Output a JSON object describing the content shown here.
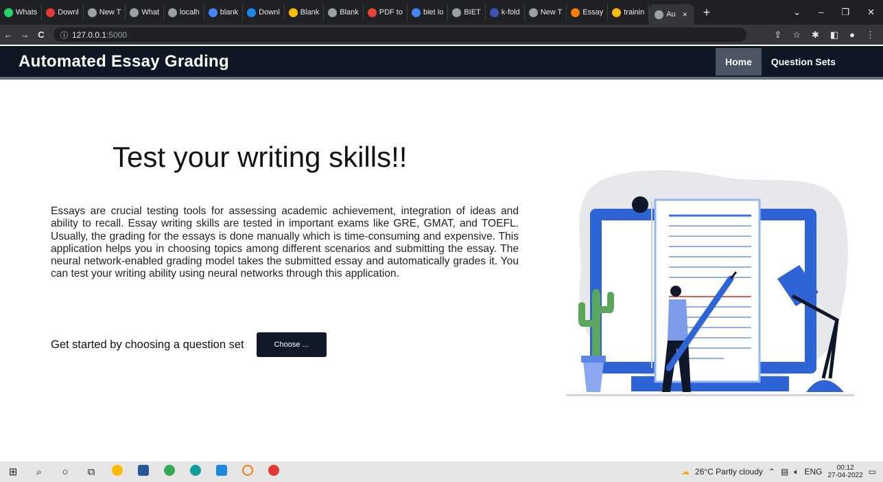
{
  "browser": {
    "tabs": [
      {
        "label": "Whats",
        "color": "#25d366"
      },
      {
        "label": "Downl",
        "color": "#e53935"
      },
      {
        "label": "New T",
        "color": "#9aa0a6"
      },
      {
        "label": "What",
        "color": "#9aa0a6"
      },
      {
        "label": "localh",
        "color": "#9aa0a6"
      },
      {
        "label": "blank",
        "color": "#4285f4"
      },
      {
        "label": "Downl",
        "color": "#1e88e5"
      },
      {
        "label": "Blank",
        "color": "#fbbc04"
      },
      {
        "label": "Blank",
        "color": "#9aa0a6"
      },
      {
        "label": "PDF to",
        "color": "#ea4335"
      },
      {
        "label": "biet lo",
        "color": "#4285f4"
      },
      {
        "label": "BIET",
        "color": "#9aa0a6"
      },
      {
        "label": "k-fold",
        "color": "#3f51b5"
      },
      {
        "label": "New T",
        "color": "#9aa0a6"
      },
      {
        "label": "Essay",
        "color": "#f57c00"
      },
      {
        "label": "trainin",
        "color": "#fbbc04"
      }
    ],
    "active_tab": {
      "label": "Au",
      "close": "×"
    },
    "new_tab": "+",
    "url_host": "127.0.0.1",
    "url_port": ":5000",
    "nav": {
      "back": "←",
      "forward": "→",
      "reload": "C",
      "info": "ⓘ"
    }
  },
  "navbar": {
    "brand": "Automated Essay Grading",
    "links": [
      {
        "label": "Home",
        "active": true
      },
      {
        "label": "Question Sets",
        "active": false
      }
    ]
  },
  "hero": {
    "title": "Test your writing skills!!",
    "paragraph": "Essays are crucial testing tools for assessing academic achievement, integration of ideas and ability to recall. Essay writing skills are tested in important exams like GRE, GMAT, and TOEFL. Usually, the grading for the essays is done manually which is time-consuming and expensive. This application helps you in choosing topics among different scenarios and submitting the essay. The neural network-enabled grading model takes the submitted essay and automatically grades it. You can test your writing ability using neural networks through this application.",
    "cta_label": "Get started by choosing a question set",
    "cta_button": "Choose ..."
  },
  "taskbar": {
    "weather": "26°C  Partly cloudy",
    "language": "ENG",
    "time": "00:12",
    "date": "27-04-2022"
  },
  "colors": {
    "navbar_bg": "#0f1724",
    "accent_blue": "#2563eb",
    "button_bg": "#111827"
  }
}
